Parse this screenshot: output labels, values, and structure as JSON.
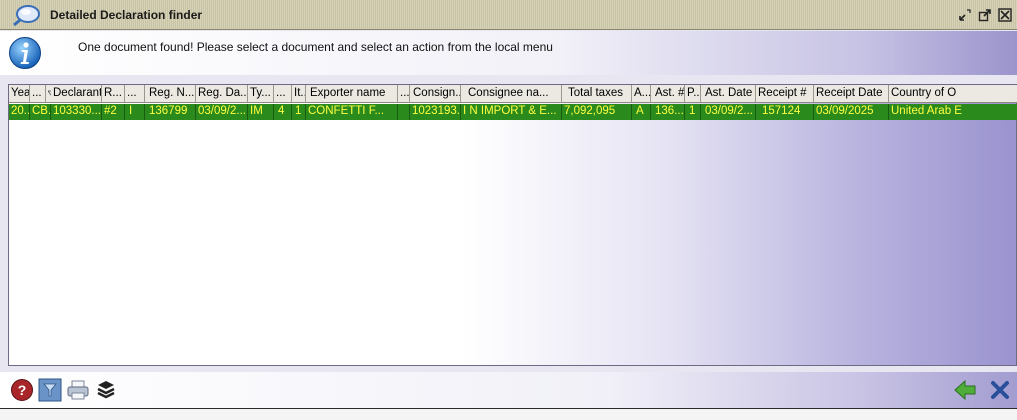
{
  "window": {
    "title": "Detailed Declaration finder"
  },
  "info": {
    "message": "One document found! Please select a document and select an action from the local menu"
  },
  "table": {
    "columns": [
      "Year",
      "...",
      "Declarant",
      "R...",
      "...",
      "Reg. N...",
      "Reg. Da...",
      "Ty...",
      "...",
      "It...",
      "Exporter name",
      "...",
      "Consign...",
      "Consignee na...",
      "Total taxes",
      "A...",
      "Ast. #",
      "P...",
      "Ast. Date",
      "Receipt #",
      "Receipt Date",
      "Country of O"
    ],
    "rows": [
      [
        "20...",
        "CB...",
        "103330...",
        "#2",
        "I",
        "136799",
        "03/09/2...",
        "IM",
        "4",
        "1",
        "CONFETTI F...",
        "",
        "1023193...",
        "I N IMPORT & E...",
        "7,092,095",
        "A",
        "136...",
        "1",
        "03/09/2...",
        "157124",
        "03/09/2025",
        "United Arab E"
      ]
    ]
  },
  "toolbar": {
    "buttons": [
      "help-icon",
      "filter-icon",
      "print-icon",
      "layers-icon",
      "ok-arrow-icon",
      "close-icon"
    ]
  },
  "colors": {
    "row_selected": "#2a8a1c",
    "row_text": "#ffff40",
    "panel_gradient_end": "#9a93cf"
  }
}
